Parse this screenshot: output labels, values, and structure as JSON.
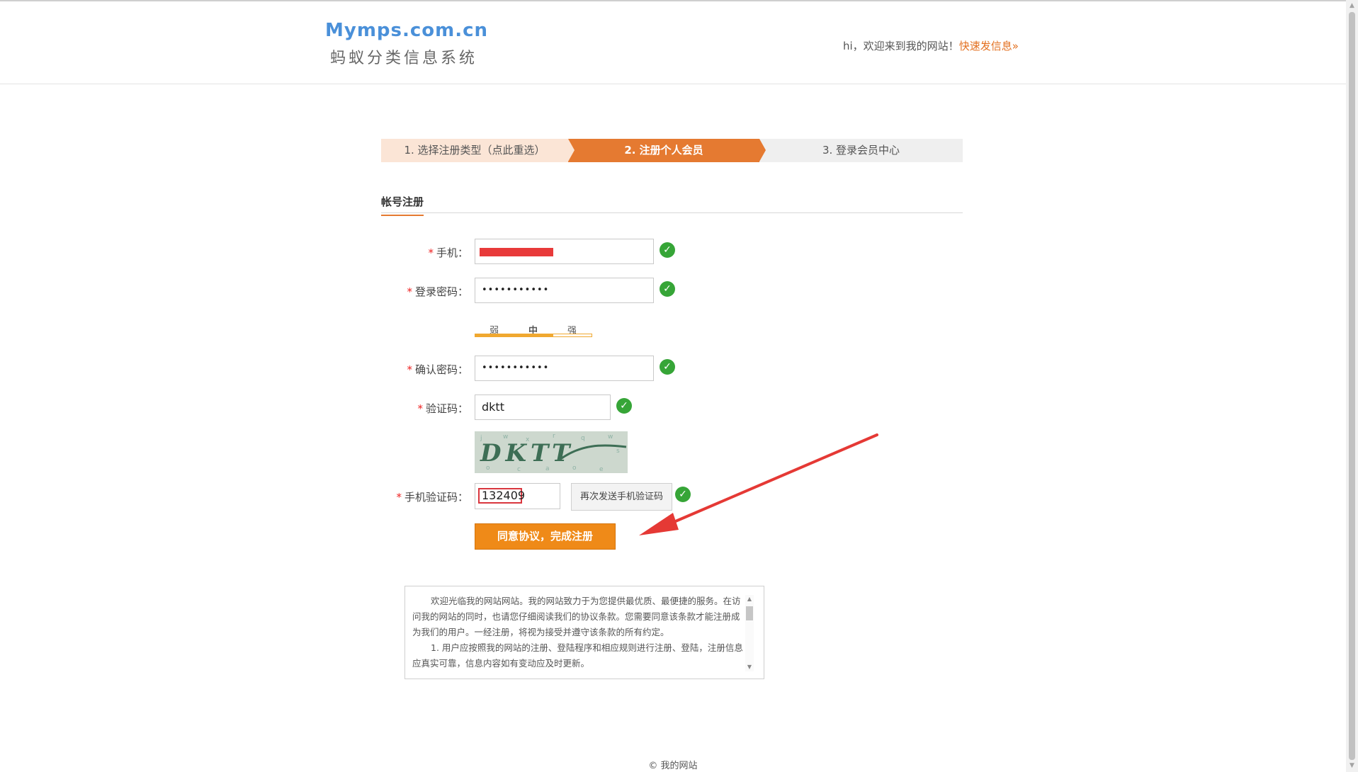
{
  "header": {
    "logo_en": "Mymps.com.cn",
    "logo_cn": "蚂蚁分类信息系统",
    "welcome": "hi，欢迎来到我的网站！",
    "quick_post": "快速发信息»"
  },
  "steps": [
    {
      "label": "1. 选择注册类型（点此重选）"
    },
    {
      "label": "2. 注册个人会员"
    },
    {
      "label": "3. 登录会员中心"
    }
  ],
  "tab": {
    "label": "帐号注册"
  },
  "form": {
    "phone_label": "手机：",
    "password_label": "登录密码：",
    "password_value": "•••••••••••",
    "strength": {
      "weak": "弱",
      "medium": "中",
      "strong": "强",
      "level_percent": 66
    },
    "confirm_label": "确认密码：",
    "confirm_value": "•••••••••••",
    "captcha_label": "验证码：",
    "captcha_value": "dktt",
    "captcha_image_text": "DKTT",
    "sms_label": "手机验证码：",
    "sms_value": "132409",
    "resend_button": "再次发送手机验证码",
    "submit_button": "同意协议，完成注册",
    "required_mark": "*",
    "check_mark": "✓"
  },
  "terms": {
    "p1": "欢迎光临我的网站网站。我的网站致力于为您提供最优质、最便捷的服务。在访问我的网站的同时，也请您仔细阅读我们的协议条款。您需要同意该条款才能注册成为我们的用户。一经注册，将视为接受并遵守该条款的所有约定。",
    "p2": "1. 用户应按照我的网站的注册、登陆程序和相应规则进行注册、登陆，注册信息应真实可靠，信息内容如有变动应及时更新。"
  },
  "footer": {
    "text": "© 我的网站"
  },
  "colors": {
    "accent": "#e57a31",
    "valid": "#36a537",
    "required": "#e22222",
    "annotation": "#e53935"
  }
}
